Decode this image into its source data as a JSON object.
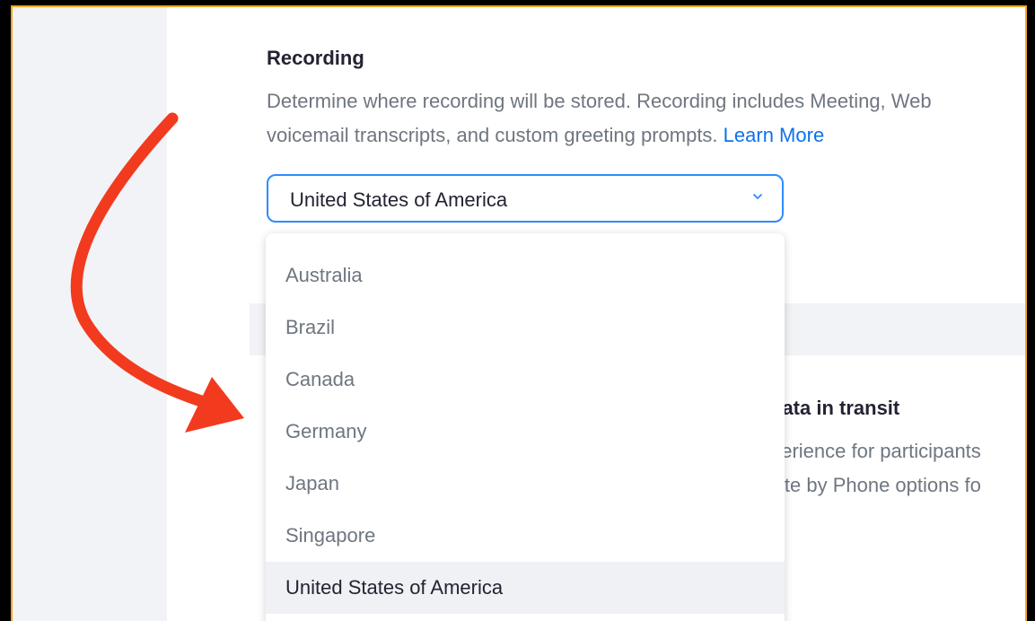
{
  "recording": {
    "title": "Recording",
    "description_line1": "Determine where recording will be stored. Recording includes Meeting, Web",
    "description_line2": "voicemail transcripts, and custom greeting prompts.",
    "learn_more": "Learn More"
  },
  "region_select": {
    "value": "United States of America",
    "options": [
      "Australia",
      "Brazil",
      "Canada",
      "Germany",
      "Japan",
      "Singapore",
      "United States of America"
    ],
    "selected_index": 6
  },
  "background_section": {
    "heading": "data in transit",
    "line1": "perience for participants",
    "line2": "vite by Phone options fo"
  },
  "colors": {
    "accent": "#2d8cff",
    "link": "#0e72ed",
    "arrow": "#f23a1f",
    "frame_border": "#f5a623"
  },
  "icons": {
    "select_chevron": "chevron-down-icon",
    "annotation": "curved-arrow-icon"
  }
}
